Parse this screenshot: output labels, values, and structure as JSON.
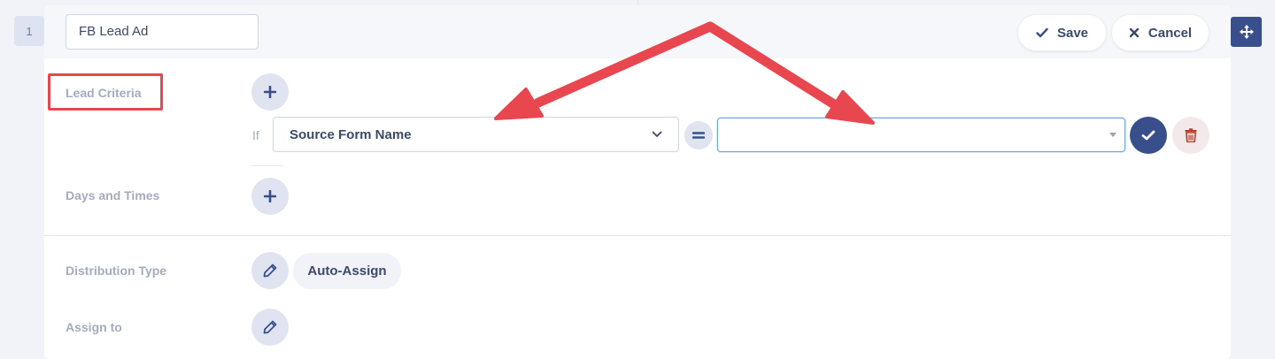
{
  "row": {
    "number": "1"
  },
  "rule": {
    "name": "FB Lead Ad"
  },
  "header": {
    "save_label": "Save",
    "cancel_label": "Cancel"
  },
  "fields": {
    "lead_criteria_label": "Lead Criteria",
    "days_times_label": "Days and Times",
    "distribution_type_label": "Distribution Type",
    "assign_to_label": "Assign to"
  },
  "condition": {
    "if_label": "If",
    "selected_field": "Source Form Name",
    "operator": "=",
    "value": ""
  },
  "distribution": {
    "value": "Auto-Assign"
  },
  "icons": {
    "save": "check-icon",
    "cancel": "x-icon",
    "move": "move-arrows-icon",
    "add": "plus-icon",
    "confirm": "check-icon",
    "delete": "trash-icon",
    "edit": "pencil-icon",
    "select": "chevron-down-icon",
    "value_select": "caret-down-icon"
  },
  "colors": {
    "primary": "#394f8c",
    "annotation": "#e8474f",
    "focus": "#6fa3e6",
    "danger": "#c0392b",
    "muted_label": "#a3acbf"
  }
}
